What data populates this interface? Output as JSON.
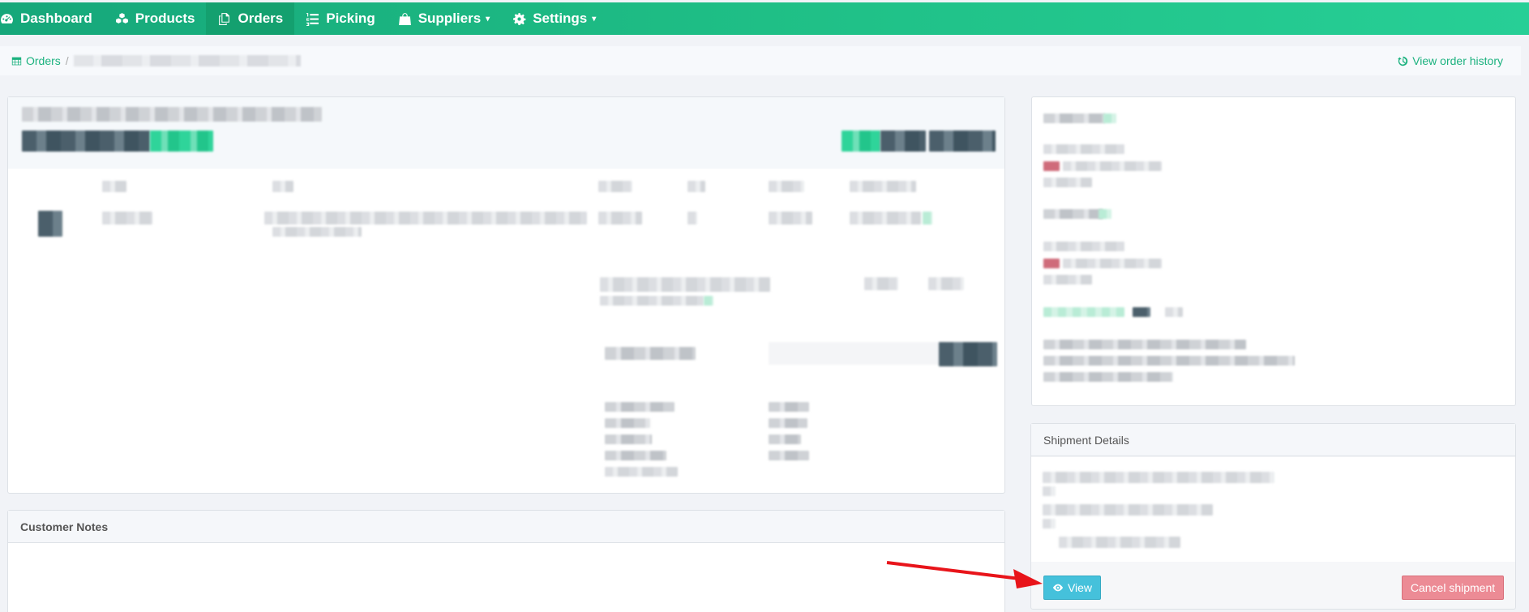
{
  "nav": {
    "items": [
      {
        "label": "Dashboard",
        "icon": "dashboard-icon",
        "active": false,
        "dropdown": false
      },
      {
        "label": "Products",
        "icon": "cubes-icon",
        "active": false,
        "dropdown": false
      },
      {
        "label": "Orders",
        "icon": "copy-icon",
        "active": true,
        "dropdown": false
      },
      {
        "label": "Picking",
        "icon": "list-ol-icon",
        "active": false,
        "dropdown": false
      },
      {
        "label": "Suppliers",
        "icon": "shopping-bag-icon",
        "active": false,
        "dropdown": true
      },
      {
        "label": "Settings",
        "icon": "gear-icon",
        "active": false,
        "dropdown": true
      }
    ]
  },
  "breadcrumb": {
    "root": "Orders",
    "separator": "/",
    "history_link": "View order history"
  },
  "customer_notes": {
    "heading": "Customer Notes"
  },
  "shipment": {
    "heading": "Shipment Details",
    "view_button": "View",
    "cancel_button": "Cancel shipment"
  },
  "colors": {
    "nav_start": "#16a77a",
    "nav_end": "#27cf96",
    "link": "#1cb27f",
    "view_button": "#45c1db",
    "cancel_button": "#ec8b95",
    "annotation_arrow": "#e8141a"
  }
}
